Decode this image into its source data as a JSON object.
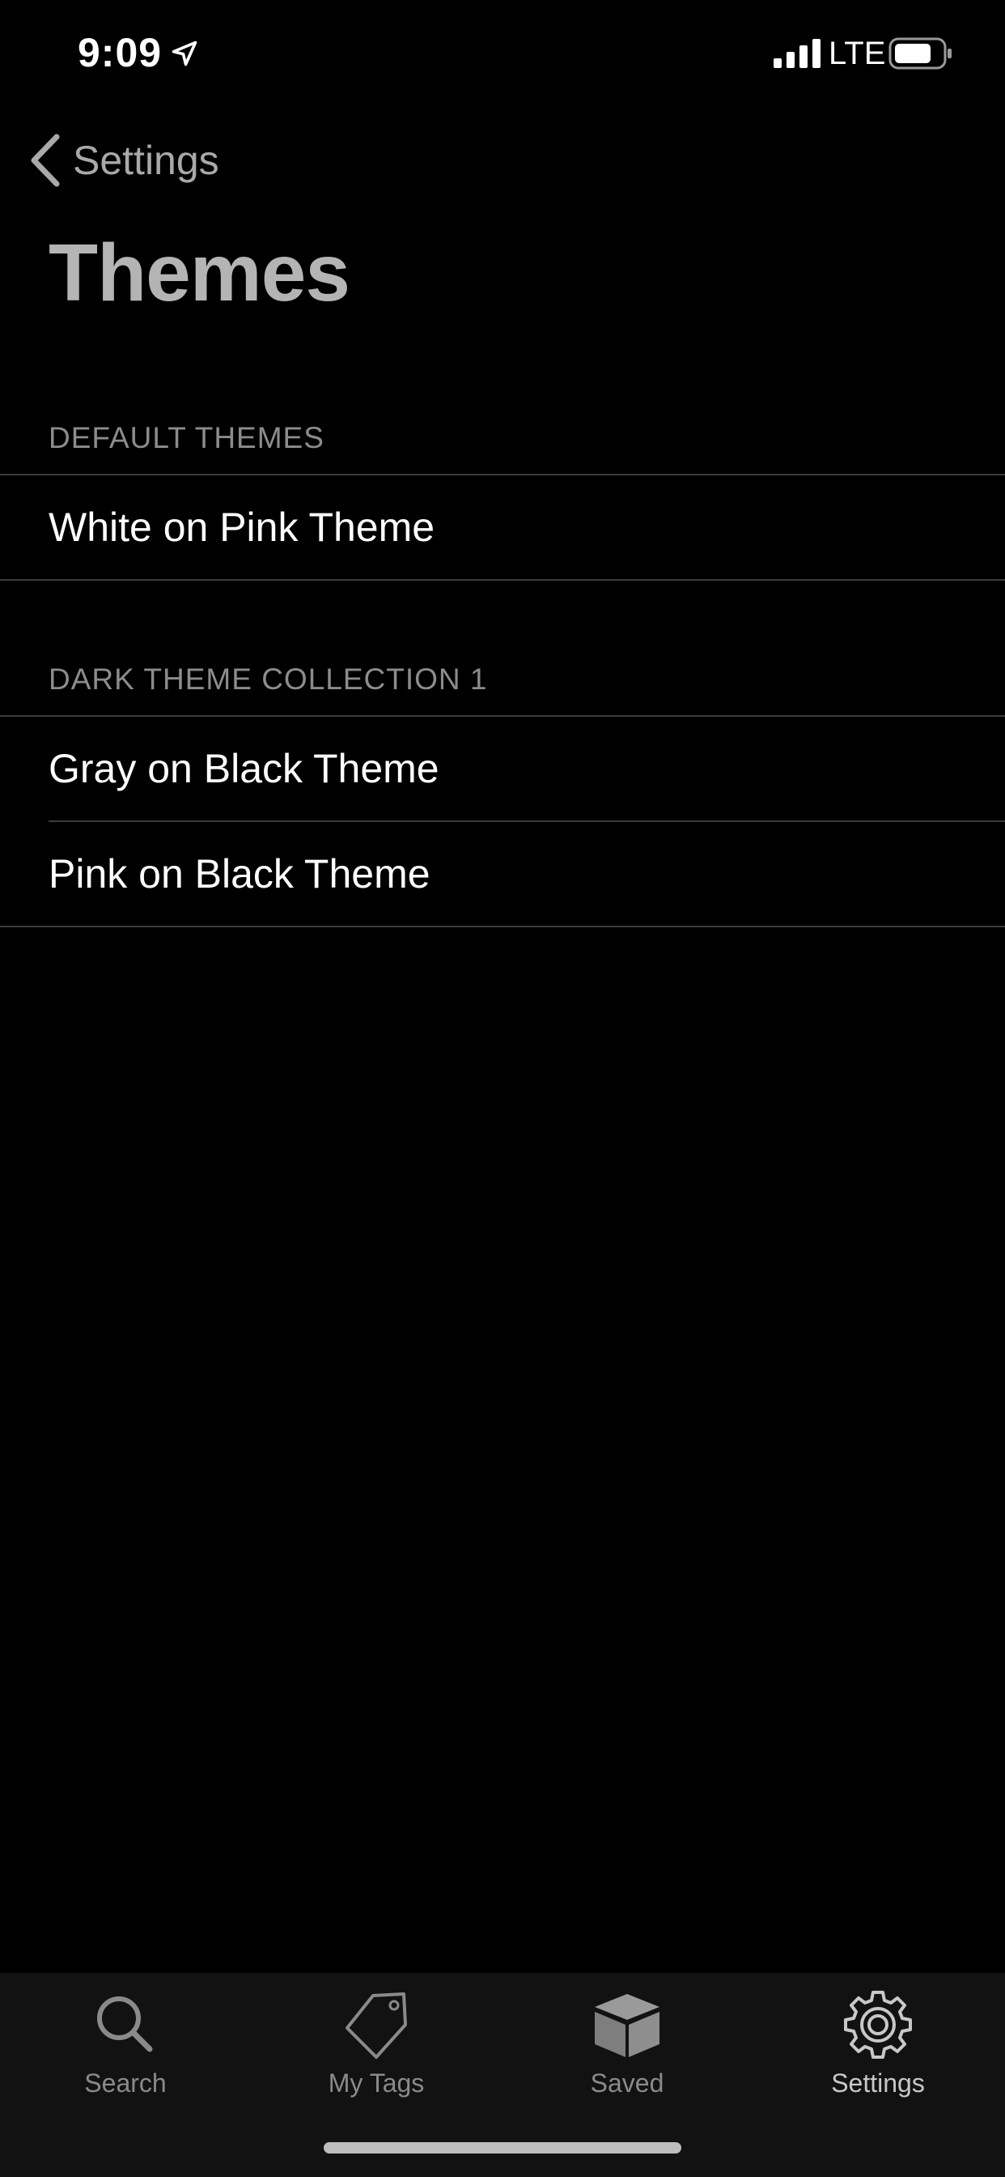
{
  "status_bar": {
    "time": "9:09",
    "network": "LTE",
    "icons": [
      "location-arrow-icon",
      "signal-bars-icon",
      "battery-icon"
    ]
  },
  "nav": {
    "back_label": "Settings",
    "back_icon": "chevron-left-icon"
  },
  "page": {
    "title": "Themes"
  },
  "sections": [
    {
      "header": "DEFAULT THEMES",
      "items": [
        {
          "label": "White on Pink Theme"
        }
      ]
    },
    {
      "header": "DARK THEME COLLECTION 1",
      "items": [
        {
          "label": "Gray on Black Theme"
        },
        {
          "label": "Pink on Black Theme"
        }
      ]
    }
  ],
  "tab_bar": {
    "tabs": [
      {
        "label": "Search",
        "icon": "search-icon",
        "active": false
      },
      {
        "label": "My Tags",
        "icon": "tag-icon",
        "active": false
      },
      {
        "label": "Saved",
        "icon": "box-icon",
        "active": false
      },
      {
        "label": "Settings",
        "icon": "gear-icon",
        "active": true
      }
    ]
  },
  "colors": {
    "background": "#000000",
    "tab_bar_background": "#121212",
    "title_text": "#b4b4b4",
    "section_header_text": "#8c8c8c",
    "row_text": "#ffffff",
    "divider": "#3c3c3c"
  }
}
